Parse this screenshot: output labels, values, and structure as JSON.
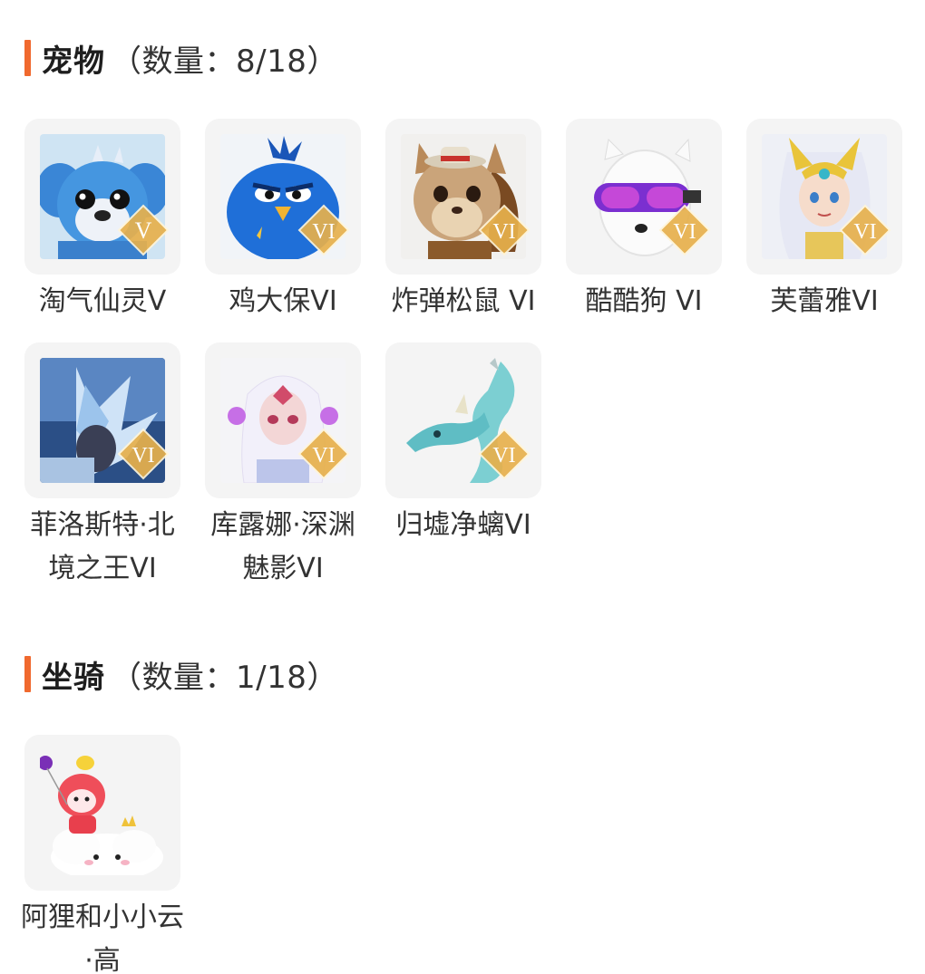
{
  "pets_section": {
    "title": "宠物",
    "count": "（数量：8/18）",
    "items": [
      {
        "name": "淘气仙灵V",
        "badge": "V",
        "icon": "blue-puppy-icon"
      },
      {
        "name": "鸡大保VI",
        "badge": "VI",
        "icon": "blue-bird-icon"
      },
      {
        "name": "炸弹松鼠 VI",
        "badge": "VI",
        "icon": "squirrel-icon"
      },
      {
        "name": "酷酷狗 VI",
        "badge": "VI",
        "icon": "goggle-dog-icon"
      },
      {
        "name": "芙蕾雅VI",
        "badge": "VI",
        "icon": "fairy-girl-icon"
      },
      {
        "name": "菲洛斯特·北境之王VI",
        "badge": "VI",
        "icon": "ice-king-icon"
      },
      {
        "name": "库露娜·深渊魅影VI",
        "badge": "VI",
        "icon": "abyss-girl-icon"
      },
      {
        "name": "归墟净螭VI",
        "badge": "VI",
        "icon": "jade-dragon-icon"
      }
    ]
  },
  "mounts_section": {
    "title": "坐骑",
    "count": "（数量：1/18）",
    "items": [
      {
        "name": "阿狸和小小云·高",
        "badge": "",
        "icon": "fox-on-cloud-icon"
      }
    ]
  },
  "colors": {
    "accent": "#f0692e",
    "badge_gold": "#e7b04c",
    "tile_bg": "#f4f4f4"
  }
}
